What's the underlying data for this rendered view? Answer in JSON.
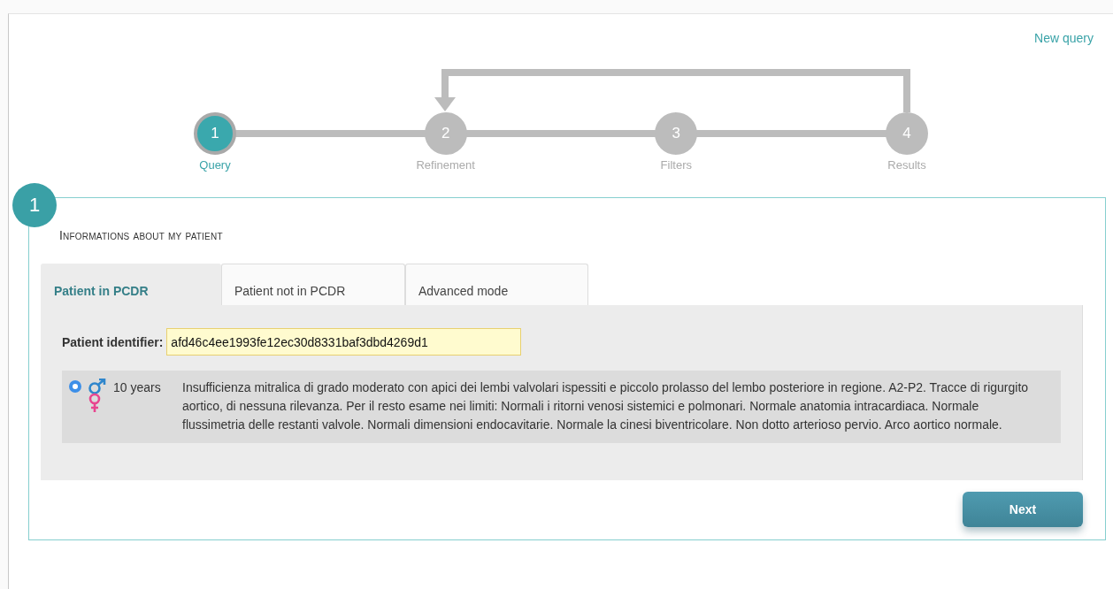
{
  "header_link": "New query",
  "steps": [
    {
      "number": "1",
      "label": "Query",
      "selected": true
    },
    {
      "number": "2",
      "label": "Refinement",
      "selected": false
    },
    {
      "number": "3",
      "label": "Filters",
      "selected": false
    },
    {
      "number": "4",
      "label": "Results",
      "selected": false
    }
  ],
  "section": {
    "number": "1",
    "title": "Informations about my patient",
    "tabs": [
      {
        "label": "Patient in PCDR",
        "selected": true
      },
      {
        "label": "Patient not in PCDR",
        "selected": false
      },
      {
        "label": "Advanced mode",
        "selected": false
      }
    ],
    "identifier": {
      "label": "Patient identifier:",
      "value": "afd46c4ee1993fe12ec30d8331baf3dbd4269d1"
    },
    "results": [
      {
        "selected": true,
        "age": "10 years",
        "description": "Insufficienza mitralica di grado moderato con apici dei lembi valvolari ispessiti e piccolo prolasso del lembo posteriore in regione. A2-P2. Tracce di rigurgito aortico, di nessuna rilevanza. Per il resto esame nei limiti: Normali i ritorni venosi sistemici e polmonari. Normale anatomia intracardiaca. Normale flussimetria delle restanti valvole. Normali dimensioni endocavitarie. Normale la cinesi biventricolare. Non dotto arterioso pervio. Arco aortico normale."
      }
    ]
  },
  "next_button": "Next"
}
